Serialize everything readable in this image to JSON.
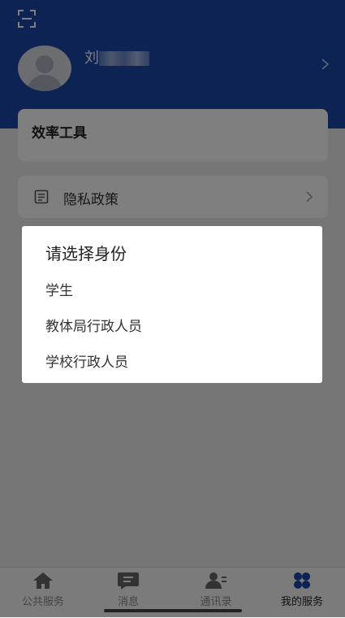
{
  "header": {
    "user_name_visible": "刘"
  },
  "cards": {
    "efficiency_title": "效率工具",
    "privacy_label": "隐私政策"
  },
  "dialog": {
    "title": "请选择身份",
    "options": [
      "学生",
      "教体局行政人员",
      "学校行政人员"
    ]
  },
  "tabs": [
    {
      "label": "公共服务",
      "icon": "home-icon"
    },
    {
      "label": "消息",
      "icon": "message-icon"
    },
    {
      "label": "通讯录",
      "icon": "contacts-icon"
    },
    {
      "label": "我的服务",
      "icon": "services-icon"
    }
  ],
  "colors": {
    "header_bg": "#1a47a6",
    "active_tab": "#1a47a6"
  }
}
